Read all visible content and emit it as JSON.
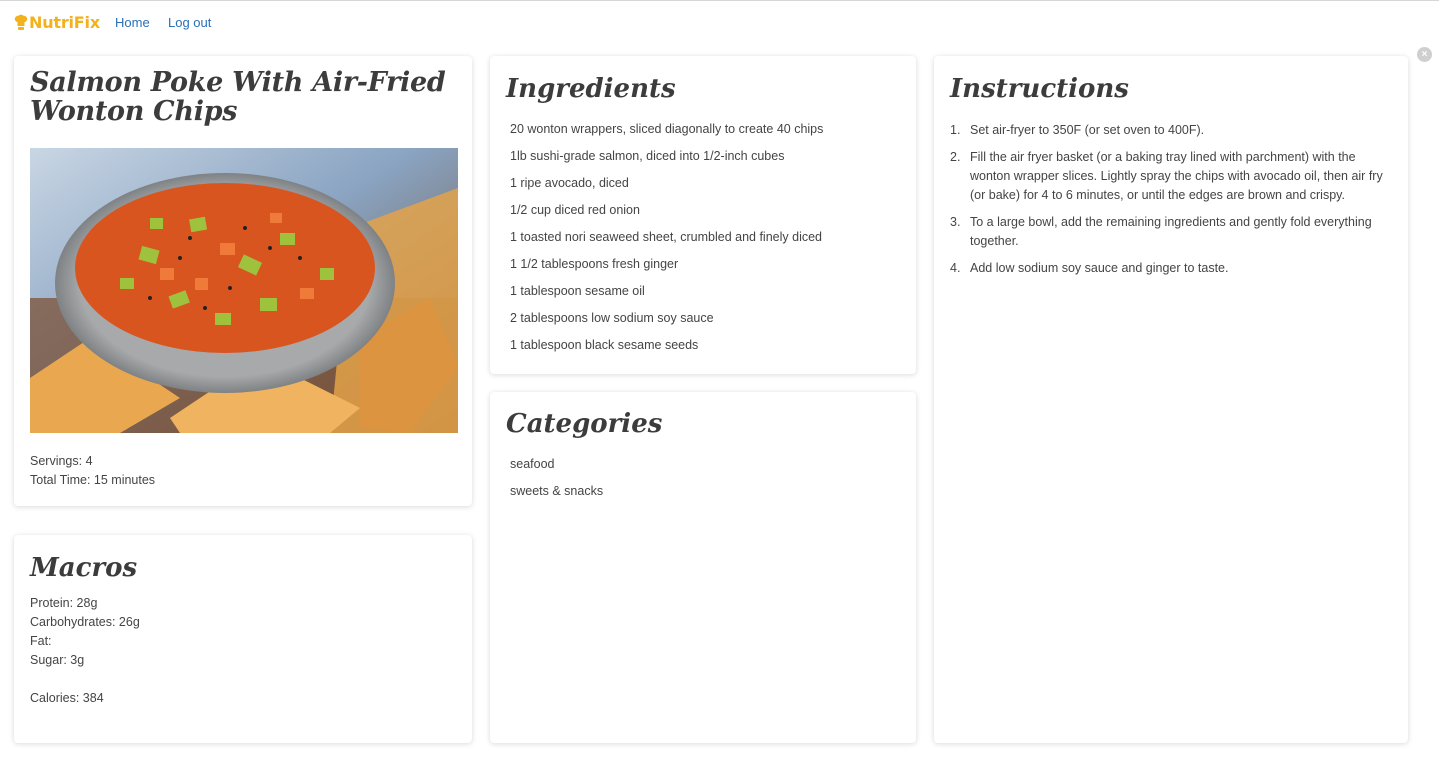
{
  "nav": {
    "brand": "NutriFix",
    "links": [
      "Home",
      "Log out"
    ],
    "close_glyph": "×"
  },
  "recipe": {
    "title": "Salmon Poke With Air-Fried Wonton Chips",
    "servings": "Servings: 4",
    "total_time": "Total Time: 15 minutes"
  },
  "macros": {
    "title": "Macros",
    "protein": "Protein: 28g",
    "carbohydrates": "Carbohydrates: 26g",
    "fat": "Fat:",
    "sugar": "Sugar: 3g",
    "calories": "Calories: 384"
  },
  "ingredients": {
    "title": "Ingredients",
    "items": [
      "20 wonton wrappers, sliced diagonally to create 40 chips",
      "1lb sushi-grade salmon, diced into 1/2-inch cubes",
      "1 ripe avocado, diced",
      "1/2 cup diced red onion",
      "1 toasted nori seaweed sheet, crumbled and finely diced",
      "1 1/2 tablespoons fresh ginger",
      "1 tablespoon sesame oil",
      "2 tablespoons low sodium soy sauce",
      "1 tablespoon black sesame seeds"
    ]
  },
  "categories": {
    "title": "Categories",
    "items": [
      "seafood",
      "sweets & snacks"
    ]
  },
  "instructions": {
    "title": "Instructions",
    "steps": [
      {
        "num": "1.",
        "text": "Set air-fryer to 350F (or set oven to 400F)."
      },
      {
        "num": "2.",
        "text": "Fill the air fryer basket (or a baking tray lined with parchment) with the wonton wrapper slices. Lightly spray the chips with avocado oil, then air fry (or bake) for 4 to 6 minutes, or until the edges are brown and crispy."
      },
      {
        "num": "3.",
        "text": "To a large bowl, add the remaining ingredients and gently fold everything together."
      },
      {
        "num": "4.",
        "text": "Add low sodium soy sauce and ginger to taste."
      }
    ]
  },
  "colors": {
    "brand": "#f3b21c",
    "link": "#2a6fb8",
    "title": "#3c3c3c"
  },
  "icons": {
    "brand": "chef-hat-icon",
    "close": "close-icon"
  }
}
